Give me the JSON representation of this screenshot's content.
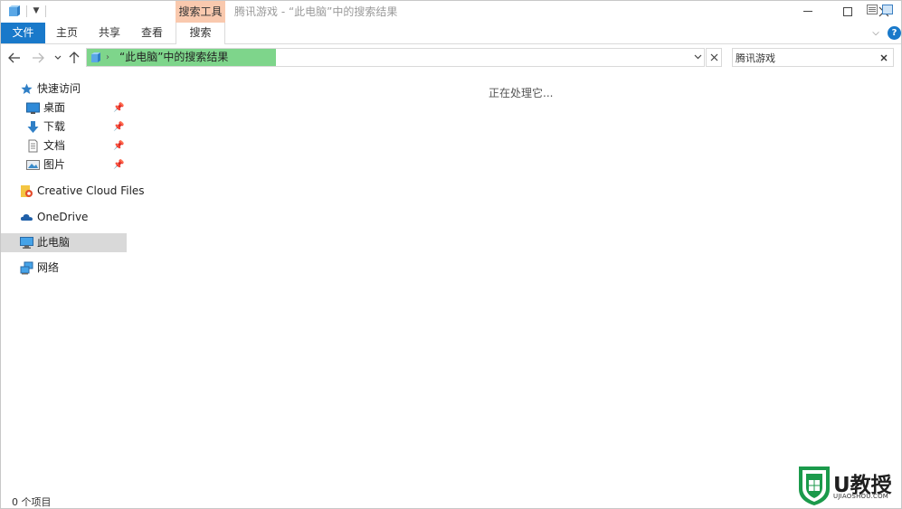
{
  "titlebar": {
    "window_title": "腾讯游戏 - “此电脑”中的搜索结果",
    "context_group": "搜索工具",
    "minimize": "minimize-icon",
    "maximize": "maximize-icon",
    "close": "close-icon"
  },
  "ribbon": {
    "tabs": {
      "file": "文件",
      "home": "主页",
      "share": "共享",
      "view": "查看",
      "search": "搜索"
    }
  },
  "navbar": {
    "address_text": "“此电脑”中的搜索结果",
    "search_value": "腾讯游戏",
    "search_placeholder": ""
  },
  "sidebar": {
    "quick_access": "快速访问",
    "items": [
      {
        "label": "桌面",
        "pinned": true,
        "icon": "desktop-icon"
      },
      {
        "label": "下载",
        "pinned": true,
        "icon": "download-icon"
      },
      {
        "label": "文档",
        "pinned": true,
        "icon": "document-icon"
      },
      {
        "label": "图片",
        "pinned": true,
        "icon": "picture-icon"
      }
    ],
    "creative_cloud": "Creative Cloud Files",
    "onedrive": "OneDrive",
    "this_pc": "此电脑",
    "network": "网络"
  },
  "content": {
    "status_message": "正在处理它..."
  },
  "statusbar": {
    "item_count": "0 个项目"
  },
  "watermark": {
    "title": "U教授",
    "subtitle": "UJIAOSHOU.COM"
  },
  "colors": {
    "accent": "#1979ca",
    "context_tab": "#f9c9ae",
    "address_highlight": "#7ed58b",
    "selected_nav": "#d9d9d9",
    "watermark_green": "#1b9a4b"
  }
}
